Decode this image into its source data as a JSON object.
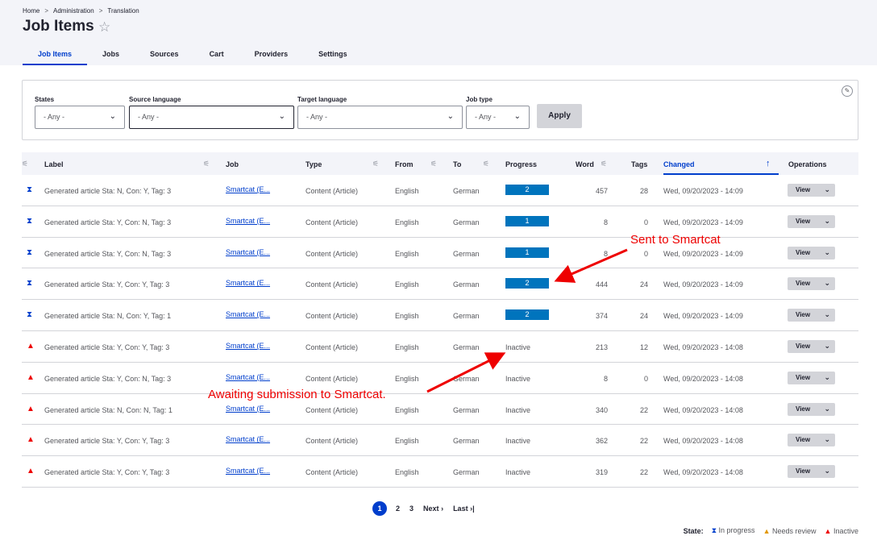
{
  "breadcrumb": [
    "Home",
    "Administration",
    "Translation"
  ],
  "breadcrumb_sep": ">",
  "title": "Job Items",
  "tabs": [
    "Job Items",
    "Jobs",
    "Sources",
    "Cart",
    "Providers",
    "Settings"
  ],
  "filters": {
    "states": {
      "label": "States",
      "value": "- Any -"
    },
    "source_language": {
      "label": "Source language",
      "value": "- Any -"
    },
    "target_language": {
      "label": "Target language",
      "value": "- Any -"
    },
    "job_type": {
      "label": "Job type",
      "value": "- Any -"
    },
    "apply": "Apply"
  },
  "columns": {
    "label": "Label",
    "job": "Job",
    "type": "Type",
    "from": "From",
    "to": "To",
    "progress": "Progress",
    "word": "Word",
    "tags": "Tags",
    "changed": "Changed",
    "operations": "Operations"
  },
  "rows": [
    {
      "state": "in-progress",
      "label": "Generated article Sta: N, Con: Y, Tag: 3",
      "job": "Smartcat (E...",
      "type": "Content (Article)",
      "from": "English",
      "to": "German",
      "progress": "2",
      "word": "457",
      "tags": "28",
      "changed": "Wed, 09/20/2023 - 14:09",
      "op": "View"
    },
    {
      "state": "in-progress",
      "label": "Generated article Sta: Y, Con: N, Tag: 3",
      "job": "Smartcat (E...",
      "type": "Content (Article)",
      "from": "English",
      "to": "German",
      "progress": "1",
      "word": "8",
      "tags": "0",
      "changed": "Wed, 09/20/2023 - 14:09",
      "op": "View"
    },
    {
      "state": "in-progress",
      "label": "Generated article Sta: Y, Con: N, Tag: 3",
      "job": "Smartcat (E...",
      "type": "Content (Article)",
      "from": "English",
      "to": "German",
      "progress": "1",
      "word": "8",
      "tags": "0",
      "changed": "Wed, 09/20/2023 - 14:09",
      "op": "View"
    },
    {
      "state": "in-progress",
      "label": "Generated article Sta: Y, Con: Y, Tag: 3",
      "job": "Smartcat (E...",
      "type": "Content (Article)",
      "from": "English",
      "to": "German",
      "progress": "2",
      "word": "444",
      "tags": "24",
      "changed": "Wed, 09/20/2023 - 14:09",
      "op": "View"
    },
    {
      "state": "in-progress",
      "label": "Generated article Sta: N, Con: Y, Tag: 1",
      "job": "Smartcat (E...",
      "type": "Content (Article)",
      "from": "English",
      "to": "German",
      "progress": "2",
      "word": "374",
      "tags": "24",
      "changed": "Wed, 09/20/2023 - 14:09",
      "op": "View"
    },
    {
      "state": "inactive",
      "label": "Generated article Sta: Y, Con: Y, Tag: 3",
      "job": "Smartcat (E...",
      "type": "Content (Article)",
      "from": "English",
      "to": "German",
      "progress": "Inactive",
      "word": "213",
      "tags": "12",
      "changed": "Wed, 09/20/2023 - 14:08",
      "op": "View"
    },
    {
      "state": "inactive",
      "label": "Generated article Sta: Y, Con: N, Tag: 3",
      "job": "Smartcat (E...",
      "type": "Content (Article)",
      "from": "English",
      "to": "German",
      "progress": "Inactive",
      "word": "8",
      "tags": "0",
      "changed": "Wed, 09/20/2023 - 14:08",
      "op": "View"
    },
    {
      "state": "inactive",
      "label": "Generated article Sta: N, Con: N, Tag: 1",
      "job": "Smartcat (E...",
      "type": "Content (Article)",
      "from": "English",
      "to": "German",
      "progress": "Inactive",
      "word": "340",
      "tags": "22",
      "changed": "Wed, 09/20/2023 - 14:08",
      "op": "View"
    },
    {
      "state": "inactive",
      "label": "Generated article Sta: Y, Con: Y, Tag: 3",
      "job": "Smartcat (E...",
      "type": "Content (Article)",
      "from": "English",
      "to": "German",
      "progress": "Inactive",
      "word": "362",
      "tags": "22",
      "changed": "Wed, 09/20/2023 - 14:08",
      "op": "View"
    },
    {
      "state": "inactive",
      "label": "Generated article Sta: Y, Con: Y, Tag: 3",
      "job": "Smartcat (E...",
      "type": "Content (Article)",
      "from": "English",
      "to": "German",
      "progress": "Inactive",
      "word": "319",
      "tags": "22",
      "changed": "Wed, 09/20/2023 - 14:08",
      "op": "View"
    }
  ],
  "pager": {
    "pages": [
      "1",
      "2",
      "3"
    ],
    "next": "Next",
    "last": "Last"
  },
  "legend": {
    "label": "State:",
    "in_progress": "In progress",
    "needs_review": "Needs review",
    "inactive": "Inactive"
  },
  "annotations": {
    "sent": "Sent to Smartcat",
    "awaiting": "Awaiting submission to Smartcat."
  },
  "colors": {
    "accent": "#003ecc",
    "progress_bar": "#0074bd",
    "inactive": "#ee0000",
    "annotation": "#ee0000"
  }
}
